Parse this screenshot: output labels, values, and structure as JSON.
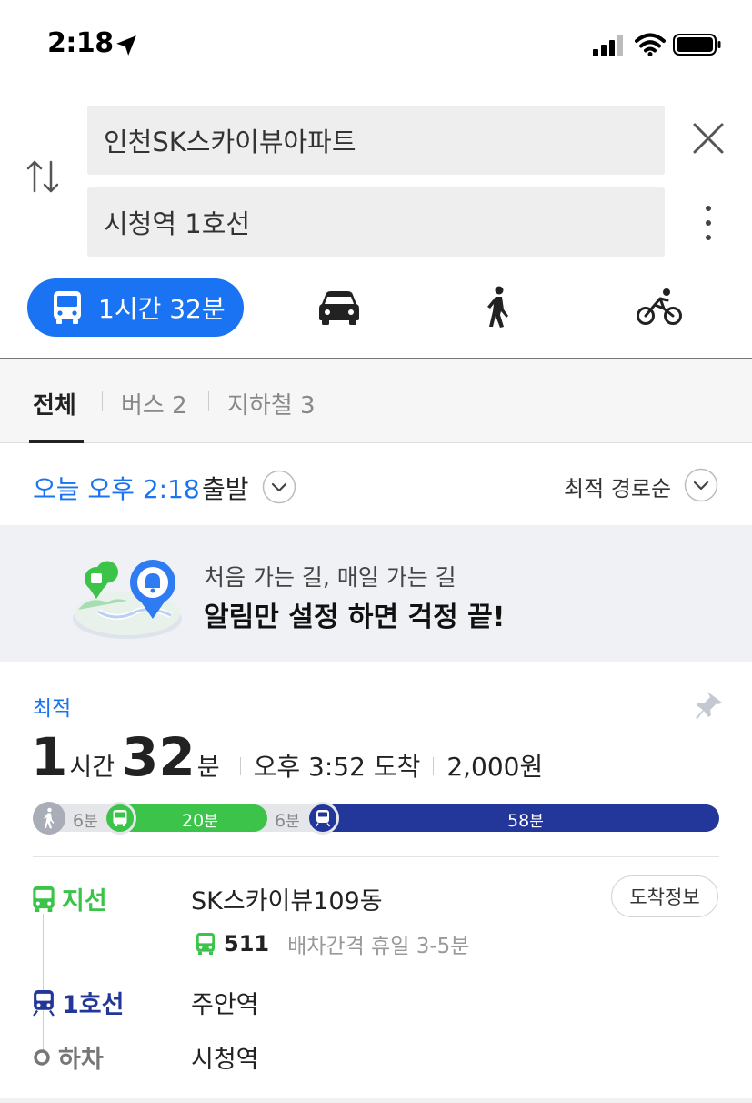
{
  "status": {
    "time": "2:18"
  },
  "search": {
    "origin": "인천SK스카이뷰아파트",
    "destination": "시청역 1호선"
  },
  "modes": {
    "transit_label": "1시간 32분",
    "selected": "transit"
  },
  "filters": {
    "all": "전체",
    "bus": "버스 2",
    "subway": "지하철 3"
  },
  "departure": {
    "time_text": "오늘 오후 2:18",
    "suffix": "출발",
    "sort": "최적 경로순"
  },
  "banner": {
    "subtitle": "처음 가는 길, 매일 가는 길",
    "title": "알림만 설정 하면 걱정 끝!"
  },
  "route": {
    "badge": "최적",
    "hours": "1",
    "hours_unit": "시간",
    "minutes": "32",
    "minutes_unit": "분",
    "arrival": "오후 3:52 도착",
    "fare": "2,000원",
    "segments": {
      "walk1_num": "6",
      "walk1_unit": "분",
      "bus_num": "20",
      "bus_unit": "분",
      "walk2_num": "6",
      "walk2_unit": "분",
      "subway_num": "58",
      "subway_unit": "분"
    },
    "steps": {
      "bus_type": "지선",
      "bus_stop": "SK스카이뷰109동",
      "arrival_info": "도착정보",
      "bus_number": "511",
      "bus_interval": "배차간격 휴일 3-5분",
      "subway_type": "1호선",
      "subway_stop": "주안역",
      "alight_type": "하차",
      "alight_stop": "시청역"
    }
  },
  "colors": {
    "accent": "#1a73f2",
    "bus_green": "#3cc44a",
    "subway_line1": "#23379a"
  }
}
